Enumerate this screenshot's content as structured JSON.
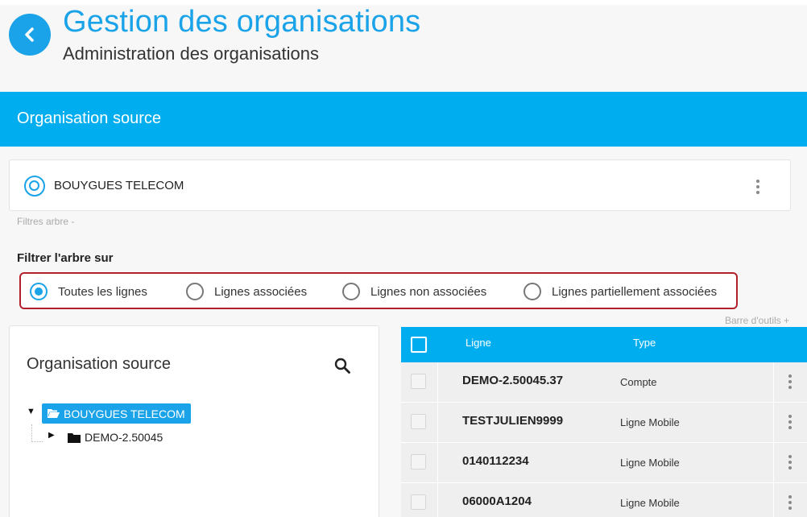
{
  "header": {
    "title": "Gestion des organisations",
    "subtitle": "Administration des organisations",
    "accent_color": "#1aa3e8"
  },
  "section": {
    "title": "Organisation source",
    "bar_color": "#00aeef"
  },
  "org_card": {
    "name": "BOUYGUES TELECOM"
  },
  "filters": {
    "tree_filters_label": "Filtres arbre -",
    "title": "Filtrer l'arbre sur",
    "selected": "Toutes les lignes",
    "options": [
      "Toutes les lignes",
      "Lignes associées",
      "Lignes non associées",
      "Lignes partiellement associées"
    ]
  },
  "toolbar": {
    "label": "Barre d'outils +"
  },
  "tree": {
    "title": "Organisation source",
    "root": {
      "label": "BOUYGUES TELECOM",
      "expanded": true,
      "icon": "folder-open-icon"
    },
    "children": [
      {
        "label": "DEMO-2.50045",
        "expanded": false,
        "icon": "folder-icon"
      }
    ]
  },
  "table": {
    "columns": {
      "ligne": "Ligne",
      "type": "Type"
    },
    "rows": [
      {
        "ligne": "DEMO-2.50045.37",
        "type": "Compte"
      },
      {
        "ligne": "TESTJULIEN9999",
        "type": "Ligne Mobile"
      },
      {
        "ligne": "0140112234",
        "type": "Ligne Mobile"
      },
      {
        "ligne": "06000A1204",
        "type": "Ligne Mobile"
      }
    ]
  }
}
